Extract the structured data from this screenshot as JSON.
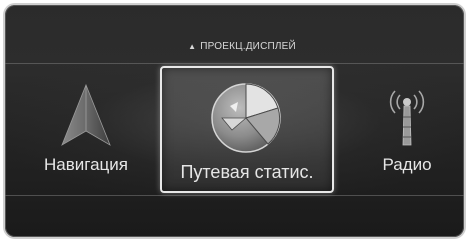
{
  "header": {
    "tab_label": "ПРОЕКЦ.ДИСПЛЕЙ"
  },
  "menu": {
    "items": [
      {
        "label": "Навигация",
        "icon": "navigation-arrow-icon",
        "selected": false
      },
      {
        "label": "Путевая статис.",
        "icon": "pie-chart-icon",
        "selected": true
      },
      {
        "label": "Радио",
        "icon": "radio-antenna-icon",
        "selected": false
      }
    ]
  },
  "colors": {
    "background": "#262626",
    "highlight_border": "#e8e8e8",
    "text": "#e6e6e6"
  }
}
